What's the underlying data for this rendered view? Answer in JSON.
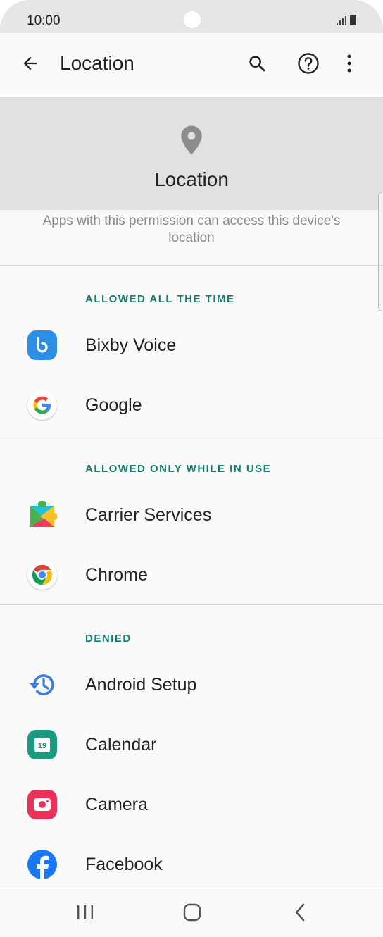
{
  "status_bar": {
    "time": "10:00"
  },
  "app_bar": {
    "title": "Location"
  },
  "header": {
    "title": "Location",
    "description": "Apps with this permission can access this device's location"
  },
  "sections": [
    {
      "label": "ALLOWED ALL THE TIME",
      "apps": [
        {
          "name": "Bixby Voice",
          "icon": "bixby-voice-icon"
        },
        {
          "name": "Google",
          "icon": "google-icon"
        }
      ]
    },
    {
      "label": "ALLOWED ONLY WHILE IN USE",
      "apps": [
        {
          "name": "Carrier Services",
          "icon": "carrier-services-icon"
        },
        {
          "name": "Chrome",
          "icon": "chrome-icon"
        }
      ]
    },
    {
      "label": "DENIED",
      "apps": [
        {
          "name": "Android Setup",
          "icon": "android-setup-icon"
        },
        {
          "name": "Calendar",
          "icon": "calendar-icon",
          "icon_text": "19"
        },
        {
          "name": "Camera",
          "icon": "camera-icon"
        },
        {
          "name": "Facebook",
          "icon": "facebook-icon"
        }
      ]
    }
  ],
  "colors": {
    "accent": "#167f74",
    "header_bg": "#e1e1e1",
    "bixby": "#2b8fe6",
    "calendar": "#1a9a7e",
    "camera": "#e8325a",
    "facebook": "#1877f2"
  }
}
